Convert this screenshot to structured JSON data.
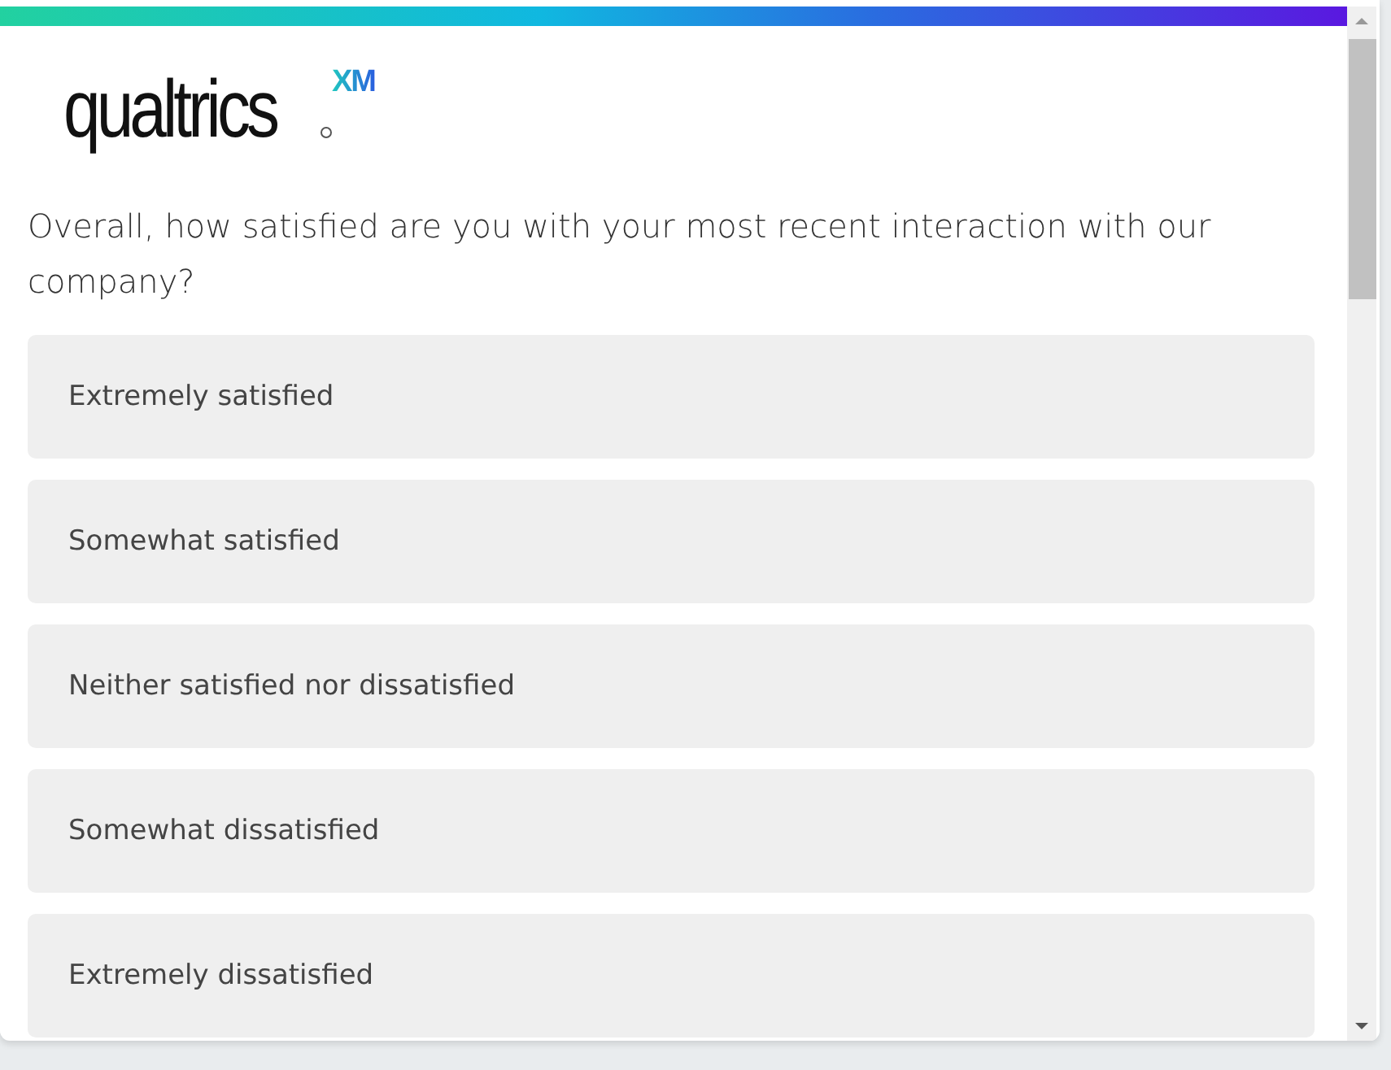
{
  "logo": {
    "wordmark": "qualtrics",
    "badge": "XM"
  },
  "question": {
    "text": "Overall, how satisfied are you with your most recent interaction with our company?"
  },
  "options": [
    {
      "label": "Extremely satisfied",
      "selected": false
    },
    {
      "label": "Somewhat satisfied",
      "selected": false
    },
    {
      "label": "Neither satisfied nor dissatisfied",
      "selected": false
    },
    {
      "label": "Somewhat dissatisfied",
      "selected": false
    },
    {
      "label": "Extremely dissatisfied",
      "selected": false
    }
  ]
}
